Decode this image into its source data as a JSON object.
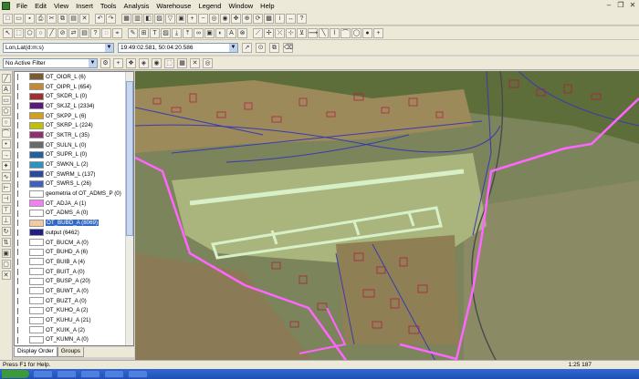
{
  "menu": [
    "File",
    "Edit",
    "View",
    "Insert",
    "Tools",
    "Analysis",
    "Warehouse",
    "Legend",
    "Window",
    "Help"
  ],
  "coords": {
    "system": "Lon,Lat(d:m:s)",
    "value": "19:49:02.581, 50:04:20.586"
  },
  "filter": {
    "label": "No Active Filter"
  },
  "layers": [
    {
      "name": "OT_OIOR_L (6)",
      "color": "#7a5b2e"
    },
    {
      "name": "OT_OIPR_L (654)",
      "color": "#c08a3a"
    },
    {
      "name": "OT_SKDR_L (0)",
      "color": "#a03030"
    },
    {
      "name": "OT_SKJZ_L (2334)",
      "color": "#5a1a7a"
    },
    {
      "name": "OT_SKPP_L (6)",
      "color": "#d0a020"
    },
    {
      "name": "OT_SKRP_L (224)",
      "color": "#c0c000"
    },
    {
      "name": "OT_SKTR_L (35)",
      "color": "#903070"
    },
    {
      "name": "OT_SULN_L (0)",
      "color": "#6a6a6a"
    },
    {
      "name": "OT_SUPR_L (0)",
      "color": "#2060a0"
    },
    {
      "name": "OT_SWKN_L (2)",
      "color": "#3090c0"
    },
    {
      "name": "OT_SWRM_L (137)",
      "color": "#2a4a9a"
    },
    {
      "name": "OT_SWRS_L (26)",
      "color": "#4060c0"
    },
    {
      "name": "geometria of OT_ADMS_P (0)",
      "color": "#ffffff"
    },
    {
      "name": "OT_ADJA_A (1)",
      "color": "#f080f0"
    },
    {
      "name": "OT_ADMS_A (0)",
      "color": "#ffffff"
    },
    {
      "name": "OT_BUBD_A (8069)",
      "color": "#f4c8a0"
    },
    {
      "name": "output (6462)",
      "color": "#202080"
    },
    {
      "name": "OT_BUCM_A (0)",
      "color": "#ffffff"
    },
    {
      "name": "OT_BUHD_A (6)",
      "color": "#ffffff"
    },
    {
      "name": "OT_BUIB_A (4)",
      "color": "#ffffff"
    },
    {
      "name": "OT_BUIT_A (0)",
      "color": "#ffffff"
    },
    {
      "name": "OT_BUSP_A (20)",
      "color": "#ffffff"
    },
    {
      "name": "OT_BUWT_A (0)",
      "color": "#ffffff"
    },
    {
      "name": "OT_BUZT_A (0)",
      "color": "#ffffff"
    },
    {
      "name": "OT_KUHO_A (2)",
      "color": "#ffffff"
    },
    {
      "name": "OT_KUHU_A (21)",
      "color": "#ffffff"
    },
    {
      "name": "OT_KUIK_A (2)",
      "color": "#ffffff"
    },
    {
      "name": "OT_KUMN_A (0)",
      "color": "#ffffff"
    }
  ],
  "selected_layer_index": 15,
  "panel_tabs": [
    "Display Order",
    "Groups"
  ],
  "status": {
    "help": "Press F1 for Help.",
    "scale": "1:25 187"
  },
  "colors": {
    "boundary": "#ff66ff",
    "runway": "#d8f0c8",
    "roads": "#3a3ab0",
    "buildings": "#b02040"
  }
}
